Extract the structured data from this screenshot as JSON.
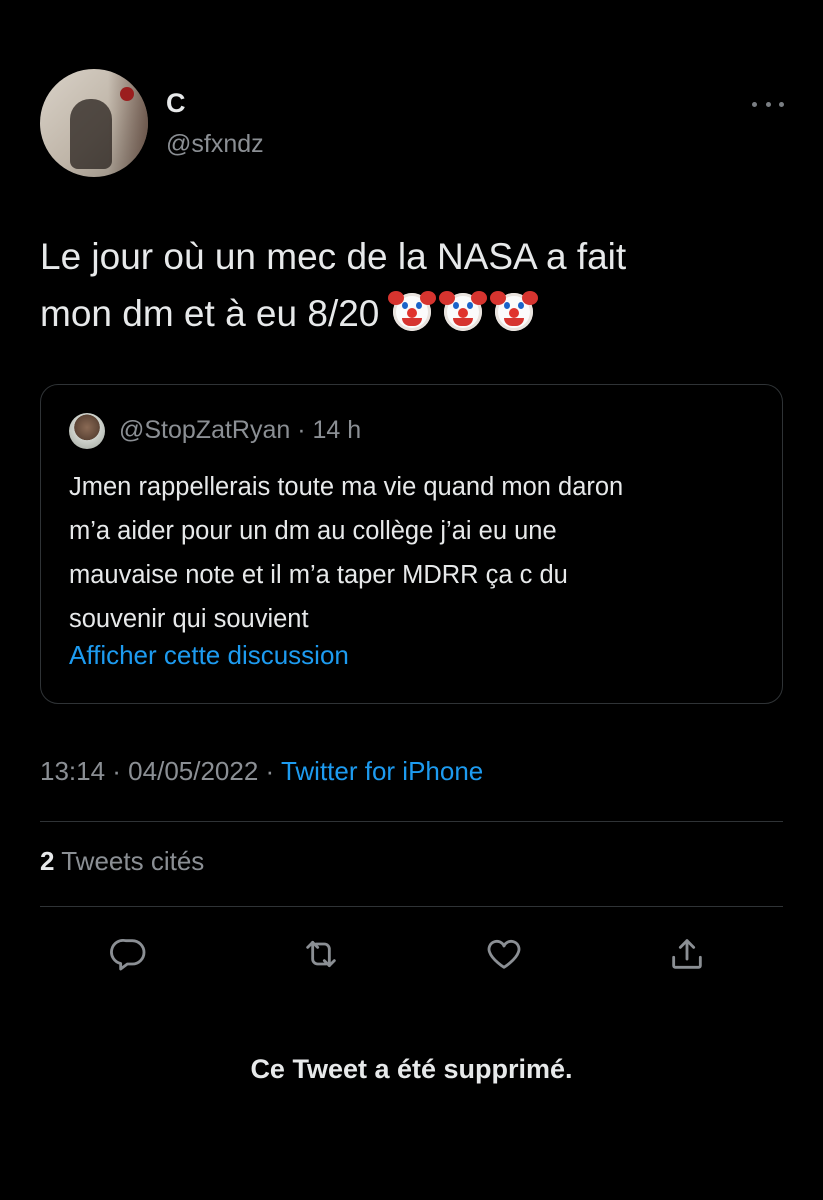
{
  "author": {
    "display_name": "C",
    "handle": "@sfxndz"
  },
  "tweet": {
    "text_line1": "Le jour où un mec de la NASA a fait",
    "text_line2": "mon dm et à eu 8/20",
    "emoji": "clown-face",
    "emoji_count": 3
  },
  "quoted_tweet": {
    "handle_time": "@StopZatRyan · 14 h",
    "lines": [
      "Jmen rappellerais toute ma vie quand mon daron",
      "m’a aider pour un dm au collège j’ai eu une",
      "mauvaise note et il m’a taper MDRR ça c du",
      "souvenir qui souvient"
    ],
    "link_label": "Afficher cette discussion"
  },
  "meta": {
    "time_date": "13:14 · 04/05/2022 · ",
    "source": "Twitter for iPhone"
  },
  "quotes": {
    "count": "2",
    "label": " Tweets cités"
  },
  "actions": {
    "icons": [
      "reply-icon",
      "retweet-icon",
      "like-icon",
      "share-icon"
    ]
  },
  "notice": {
    "deleted": "Ce Tweet a été supprimé."
  },
  "colors": {
    "background": "#000000",
    "text": "#e7e9ea",
    "secondary": "#8b8f94",
    "link": "#1d9bf0",
    "border": "#2f3336"
  }
}
